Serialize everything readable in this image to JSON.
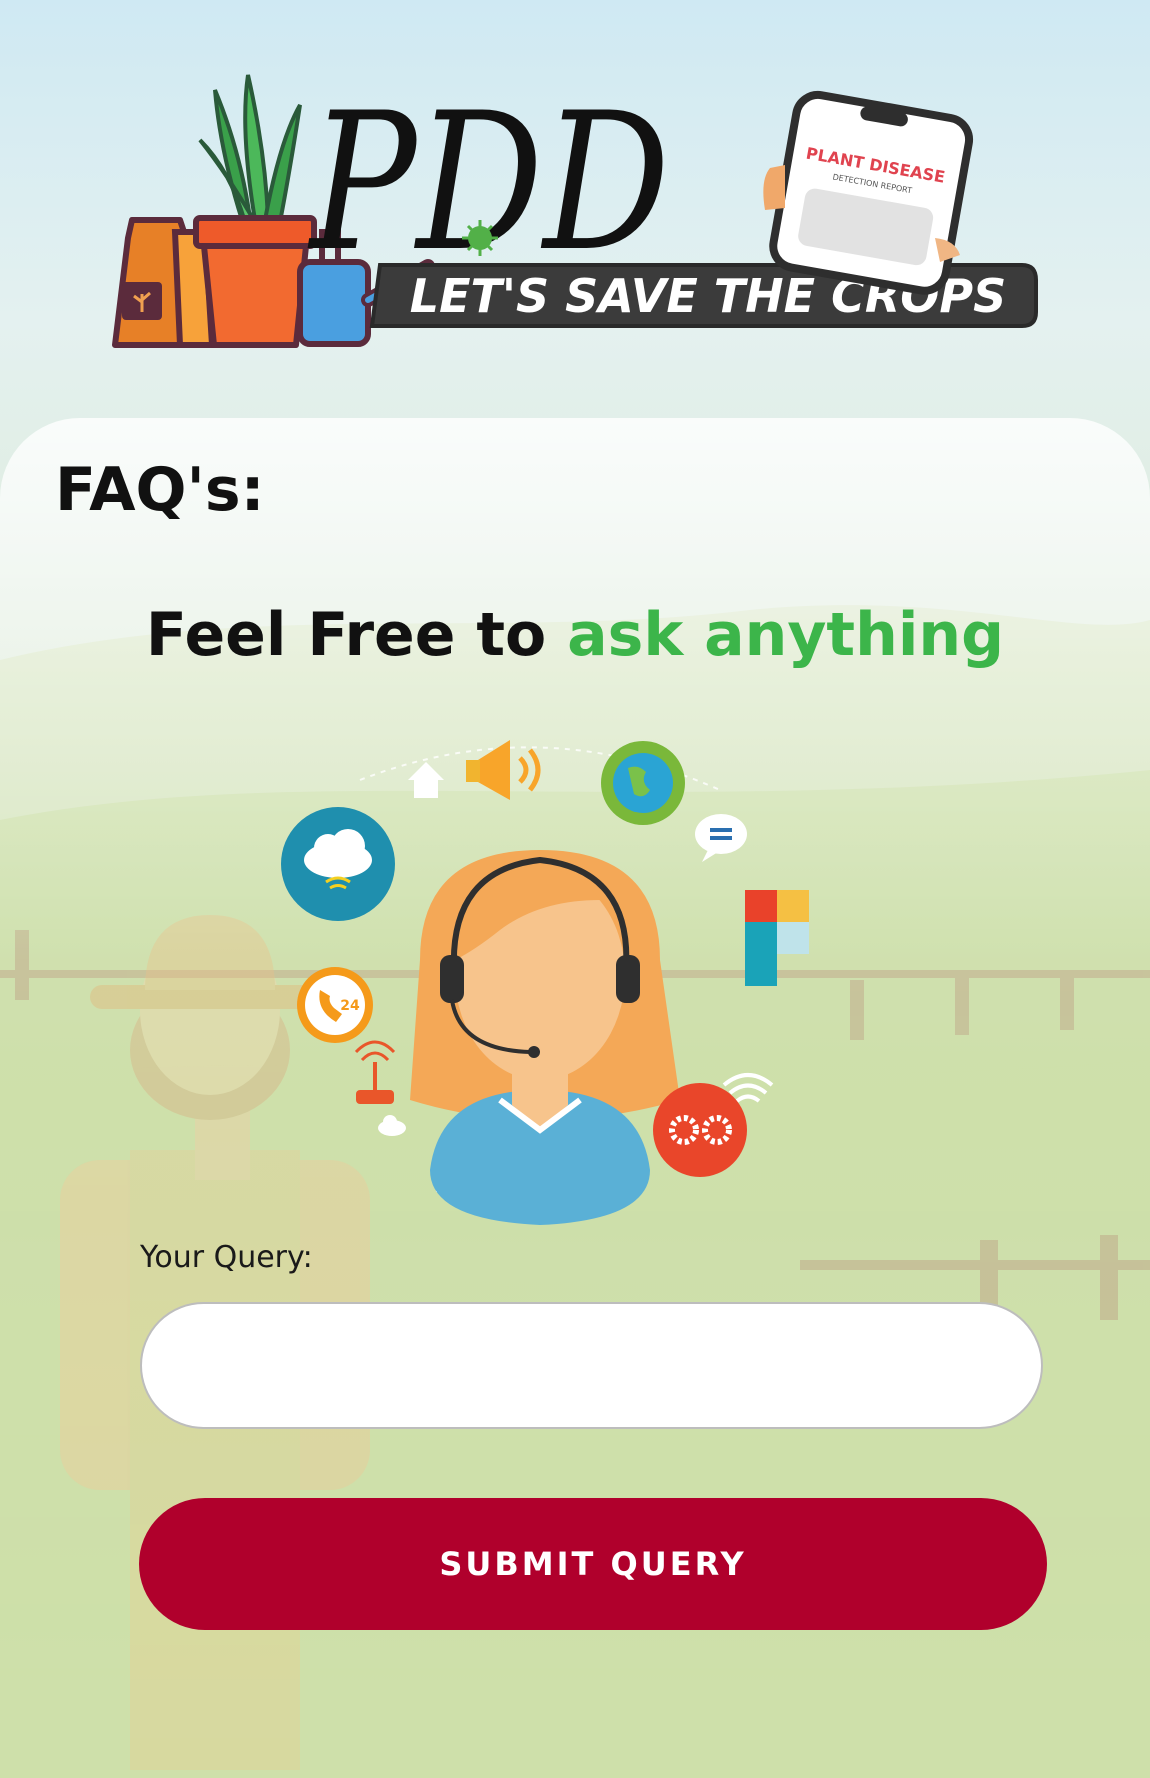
{
  "logo": {
    "wordmark": "PDD",
    "tagline": "LET'S SAVE THE CROPS",
    "phone_text": "PLANT DISEASE",
    "phone_subtext": "DETECTION REPORT"
  },
  "faq": {
    "title": "FAQ's:",
    "headline_prefix": "Feel Free to",
    "headline_accent": "ask anything"
  },
  "illustration": {
    "phone_badge": "24"
  },
  "form": {
    "query_label": "Your Query:",
    "query_value": "",
    "query_placeholder": "",
    "submit_label": "SUBMIT QUERY"
  },
  "colors": {
    "accent_green": "#3cb54a",
    "submit_button": "#b0002c",
    "tagline_banner": "#3b3b3b"
  }
}
